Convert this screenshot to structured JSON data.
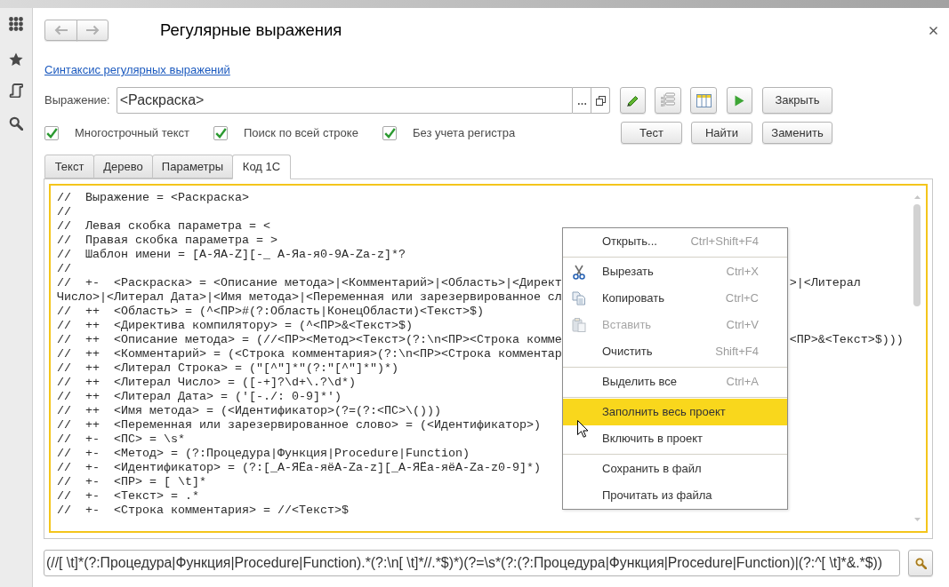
{
  "window": {
    "title": "Регулярные выражения"
  },
  "link": "Синтаксис регулярных выражений",
  "expression": {
    "label": "Выражение:",
    "value": "<Раскраска>"
  },
  "close_button": "Закрыть",
  "options": [
    {
      "label": "Многострочный текст",
      "checked": true
    },
    {
      "label": "Поиск по всей строке",
      "checked": true
    },
    {
      "label": "Без учета регистра",
      "checked": true
    }
  ],
  "action_buttons": [
    {
      "label": "Тест"
    },
    {
      "label": "Найти"
    },
    {
      "label": "Заменить"
    }
  ],
  "tabs": [
    {
      "label": "Текст",
      "selected": false
    },
    {
      "label": "Дерево",
      "selected": false
    },
    {
      "label": "Параметры",
      "selected": false
    },
    {
      "label": "Код 1С",
      "selected": true
    }
  ],
  "code": {
    "lines": [
      {
        "text": "//  Выражение = <Раскраска>"
      },
      {
        "text": "//"
      },
      {
        "text": "//  Левая скобка параметра = <"
      },
      {
        "text": "//  Правая скобка параметра = >"
      },
      {
        "text": "//  Шаблон имени = [А-ЯA-Z][-_ А-Яа-я0-9A-Za-z]*?"
      },
      {
        "text": "//"
      },
      {
        "text": "//  +-  <Раскраска> = <Описание метода>|<Комментарий>|<Область>|<Директ",
        "text_right": ">|<Литерал"
      },
      {
        "text": "Число>|<Литерал Дата>|<Имя метода>|<Переменная или зарезервированное сл"
      },
      {
        "text": "//  ++  <Область> = (^<ПР>#(?:Область|КонецОбласти)<Текст>$)"
      },
      {
        "text": "//  ++  <Директива компилятору> = (^<ПР>&<Текст>$)"
      },
      {
        "text": "//  ++  <Описание метода> = (//<ПР><Метод><Текст>(?:\\n<ПР><Строка комме",
        "text_right": "<ПР>&<Текст>$)))"
      },
      {
        "text": "//  ++  <Комментарий> = (<Строка комментария>(?:\\n<ПР><Строка комментар"
      },
      {
        "text": "//  ++  <Литерал Строка> = (\"[^\"]*\"(?:\"[^\"]*\")*)"
      },
      {
        "text": "//  ++  <Литерал Число> = ([-+]?\\d+\\.?\\d*)"
      },
      {
        "text": "//  ++  <Литерал Дата> = ('[-./: 0-9]*')"
      },
      {
        "text": "//  ++  <Имя метода> = (<Идентификатор>(?=(?:<ПС>\\()))"
      },
      {
        "text": "//  ++  <Переменная или зарезервированное слово> = (<Идентификатор>)"
      },
      {
        "text": "//  +-  <ПС> = \\s*"
      },
      {
        "text": "//  +-  <Метод> = (?:Процедура|Функция|Procedure|Function)"
      },
      {
        "text": "//  +-  <Идентификатор> = (?:[_А-ЯЁа-яёA-Za-z][_А-ЯЁа-яёA-Za-z0-9]*)"
      },
      {
        "text": "//  +-  <ПР> = [ \\t]*"
      },
      {
        "text": "//  +-  <Текст> = .*"
      },
      {
        "text": "//  +-  <Строка комментария> = //<Текст>$"
      }
    ]
  },
  "context_menu": {
    "groups": [
      [
        {
          "label": "Открыть...",
          "shortcut": "Ctrl+Shift+F4",
          "disabled": false,
          "highlighted": false
        }
      ],
      [
        {
          "label": "Вырезать",
          "shortcut": "Ctrl+X",
          "disabled": false,
          "highlighted": false
        },
        {
          "label": "Копировать",
          "shortcut": "Ctrl+C",
          "disabled": false,
          "highlighted": false
        },
        {
          "label": "Вставить",
          "shortcut": "Ctrl+V",
          "disabled": true,
          "highlighted": false
        },
        {
          "label": "Очистить",
          "shortcut": "Shift+F4",
          "disabled": false,
          "highlighted": false
        }
      ],
      [
        {
          "label": "Выделить все",
          "shortcut": "Ctrl+A",
          "disabled": false,
          "highlighted": false
        }
      ],
      [
        {
          "label": "Заполнить весь проект",
          "disabled": false,
          "highlighted": true
        },
        {
          "label": "Включить в проект",
          "disabled": false,
          "highlighted": false
        }
      ],
      [
        {
          "label": "Сохранить в файл",
          "disabled": false,
          "highlighted": false
        },
        {
          "label": "Прочитать из файла",
          "disabled": false,
          "highlighted": false
        }
      ]
    ]
  },
  "result_field": {
    "value": "(//[ \\t]*(?:Процедура|Функция|Procedure|Function).*(?:\\n[ \\t]*//.*$)*)(?=\\s*(?:(?:Процедура|Функция|Procedure|Function)|(?:^[ \\t]*&.*$))"
  }
}
